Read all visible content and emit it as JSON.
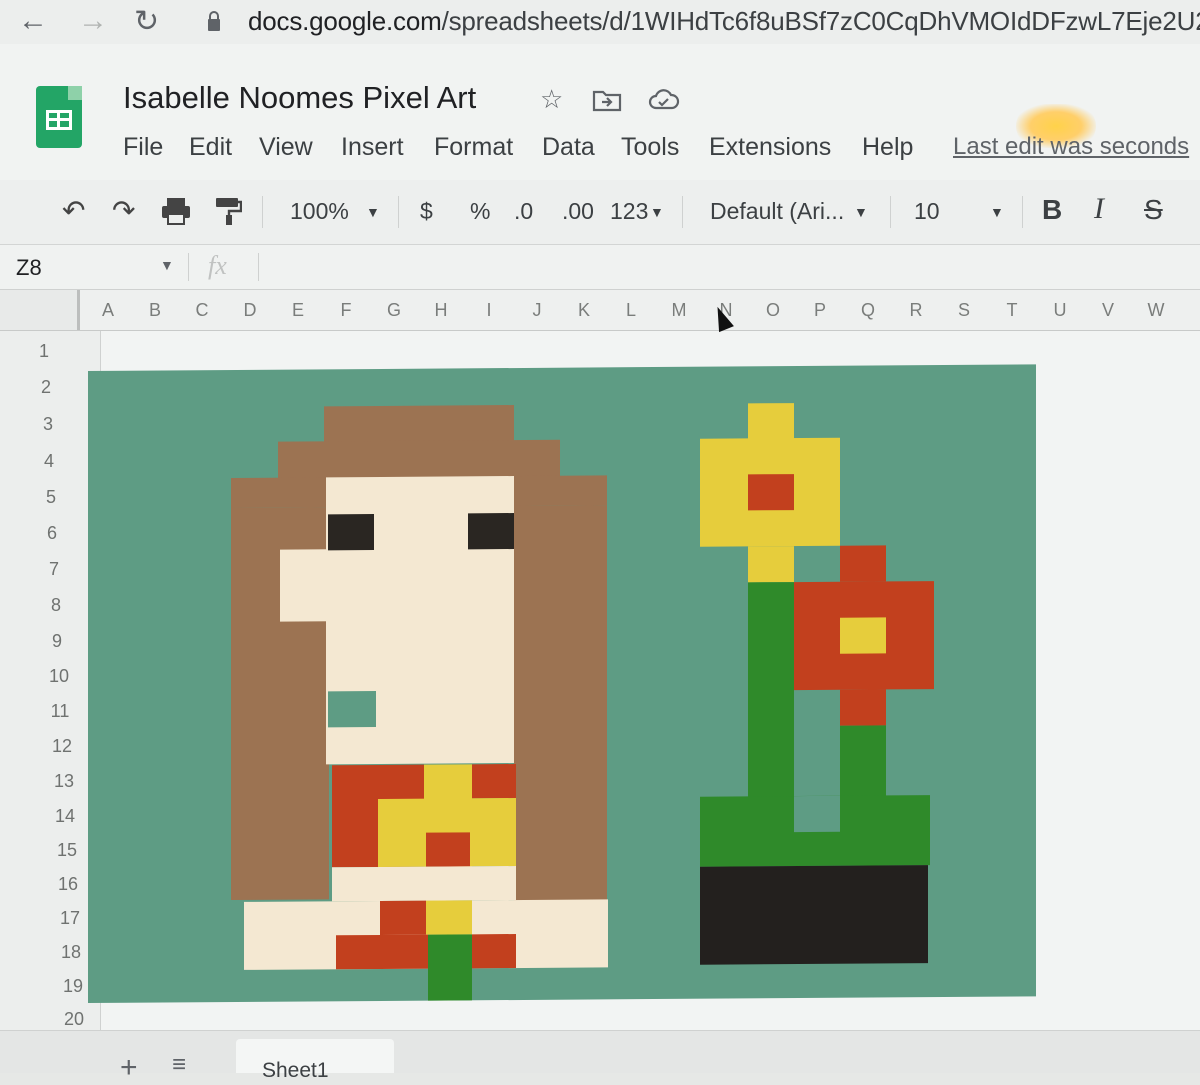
{
  "browser": {
    "url_host": "docs.google.com",
    "url_path": "/spreadsheets/d/1WIHdTc6f8uBSf7zC0CqDhVMOIdDFzwL7Eje2U2"
  },
  "document": {
    "title": "Isabelle Noomes Pixel Art",
    "last_edit": "Last edit was seconds"
  },
  "menu": [
    "File",
    "Edit",
    "View",
    "Insert",
    "Format",
    "Data",
    "Tools",
    "Extensions",
    "Help"
  ],
  "toolbar": {
    "zoom": "100%",
    "currency": "$",
    "percent": "%",
    "decrease_decimal": ".0",
    "increase_decimal": ".00",
    "more_formats": "123",
    "font": "Default (Ari...",
    "font_size": "10",
    "bold": "B",
    "italic": "I",
    "strike": "S"
  },
  "formula_bar": {
    "cell_ref": "Z8",
    "fx": "fx"
  },
  "columns": [
    "A",
    "B",
    "C",
    "D",
    "E",
    "F",
    "G",
    "H",
    "I",
    "J",
    "K",
    "L",
    "M",
    "N",
    "O",
    "P",
    "Q",
    "R",
    "S",
    "T",
    "U",
    "V",
    "W"
  ],
  "rows": [
    "1",
    "2",
    "3",
    "4",
    "5",
    "6",
    "7",
    "8",
    "9",
    "10",
    "11",
    "12",
    "13",
    "14",
    "15",
    "16",
    "17",
    "18",
    "19",
    "20"
  ],
  "sheet_tabs": [
    "Sheet1"
  ],
  "colors": {
    "background": "#5e9c84",
    "hair": "#9c7352",
    "skin": "#f4e8d2",
    "eyes": "#2a2622",
    "red": "#c2401e",
    "yellow": "#e6cd3c",
    "green": "#2f8a2a",
    "pot": "#23201e"
  }
}
